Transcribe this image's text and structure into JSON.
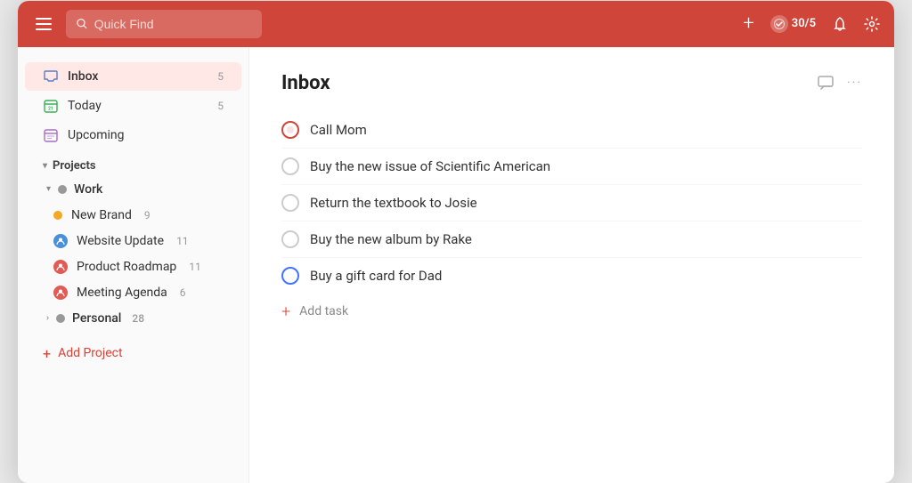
{
  "header": {
    "search_placeholder": "Quick Find",
    "karma_label": "30/5",
    "add_icon": "+",
    "bell_icon": "🔔",
    "gear_icon": "⚙"
  },
  "sidebar": {
    "nav_items": [
      {
        "id": "inbox",
        "label": "Inbox",
        "count": "5",
        "active": true
      },
      {
        "id": "today",
        "label": "Today",
        "count": "5",
        "active": false
      },
      {
        "id": "upcoming",
        "label": "Upcoming",
        "count": "",
        "active": false
      }
    ],
    "projects_label": "Projects",
    "work_group": {
      "label": "Work",
      "count": "",
      "projects": [
        {
          "id": "new-brand",
          "label": "New Brand",
          "count": "9",
          "icon_type": "dot",
          "icon_color": "yellow"
        },
        {
          "id": "website-update",
          "label": "Website Update",
          "count": "11",
          "icon_type": "person",
          "icon_color": "blue"
        },
        {
          "id": "product-roadmap",
          "label": "Product Roadmap",
          "count": "11",
          "icon_type": "person",
          "icon_color": "red"
        },
        {
          "id": "meeting-agenda",
          "label": "Meeting Agenda",
          "count": "6",
          "icon_type": "person",
          "icon_color": "red"
        }
      ]
    },
    "personal_group": {
      "label": "Personal",
      "count": "28"
    },
    "add_project_label": "Add Project"
  },
  "content": {
    "title": "Inbox",
    "tasks": [
      {
        "id": 1,
        "text": "Call Mom",
        "priority": "1"
      },
      {
        "id": 2,
        "text": "Buy the new issue of Scientific American",
        "priority": "4"
      },
      {
        "id": 3,
        "text": "Return the textbook to Josie",
        "priority": "4"
      },
      {
        "id": 4,
        "text": "Buy the new album by Rake",
        "priority": "4"
      },
      {
        "id": 5,
        "text": "Buy a gift card for Dad",
        "priority": "3"
      }
    ],
    "add_task_label": "Add task"
  }
}
